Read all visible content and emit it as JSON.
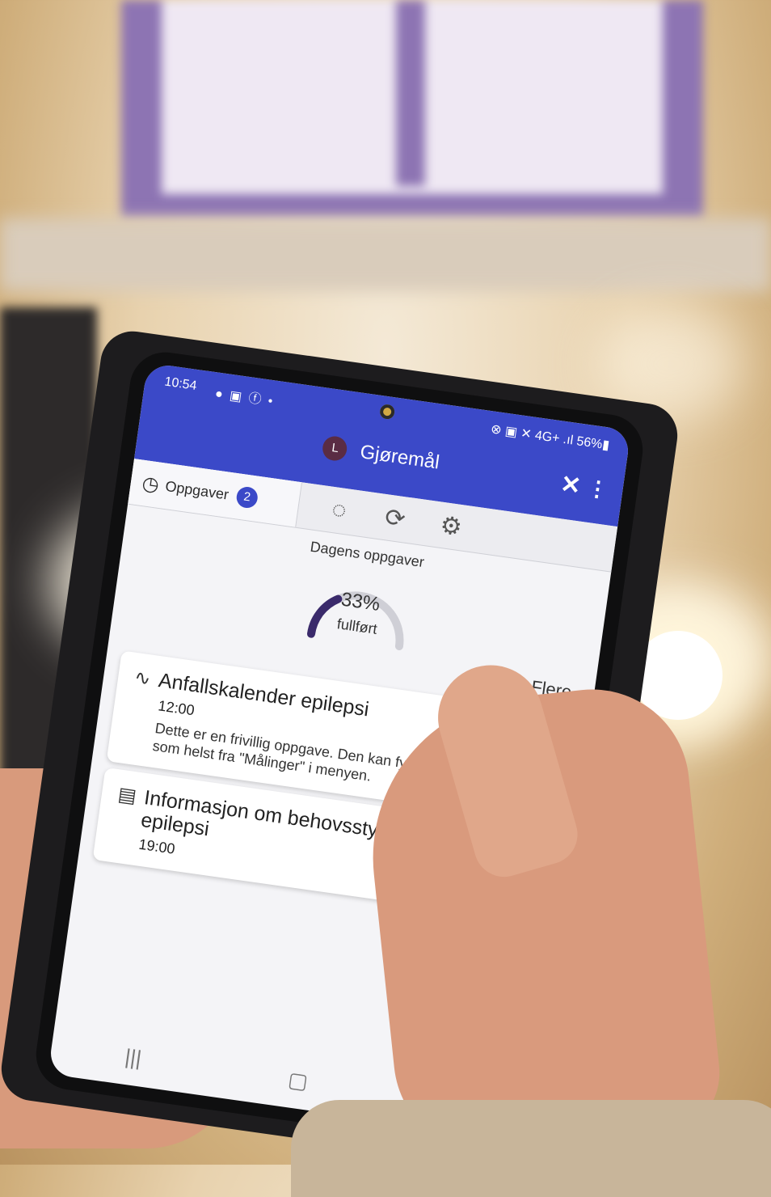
{
  "status_bar": {
    "time": "10:54",
    "notifications": "● ▣ ⓕ •",
    "right": "⊗ ▣ ✕ 4G+ .ıl 56%▮"
  },
  "app_bar": {
    "avatar_letter": "L",
    "title": "Gjøremål",
    "close_icon": "✕",
    "more_icon": "⋮"
  },
  "tabs": {
    "tasks_label": "Oppgaver",
    "tasks_badge": "2",
    "tasks_icon": "clock-check-icon",
    "icons": [
      "progress-icon",
      "sync-icon",
      "settings-icon"
    ]
  },
  "progress": {
    "label": "Dagens oppgaver",
    "percent_text": "33%",
    "percent_value": 33,
    "sub": "fullført"
  },
  "more_link": "Flere",
  "cards": [
    {
      "icon": "chart-line-icon",
      "title": "Anfallskalender epilepsi",
      "time": "12:00",
      "description": "Dette er en frivillig oppgave. Den kan fylles inn når som helst fra \"Målinger\" i menyen."
    },
    {
      "icon": "book-icon",
      "title": "Informasjon om behovsstyrt oppfølging av epilepsi",
      "time": "19:00"
    }
  ],
  "colors": {
    "app_bar": "#3b49c8",
    "badge": "#3b49c8",
    "arrow_button": "#3a2a6b",
    "gauge_fill": "#3a2a6b"
  }
}
